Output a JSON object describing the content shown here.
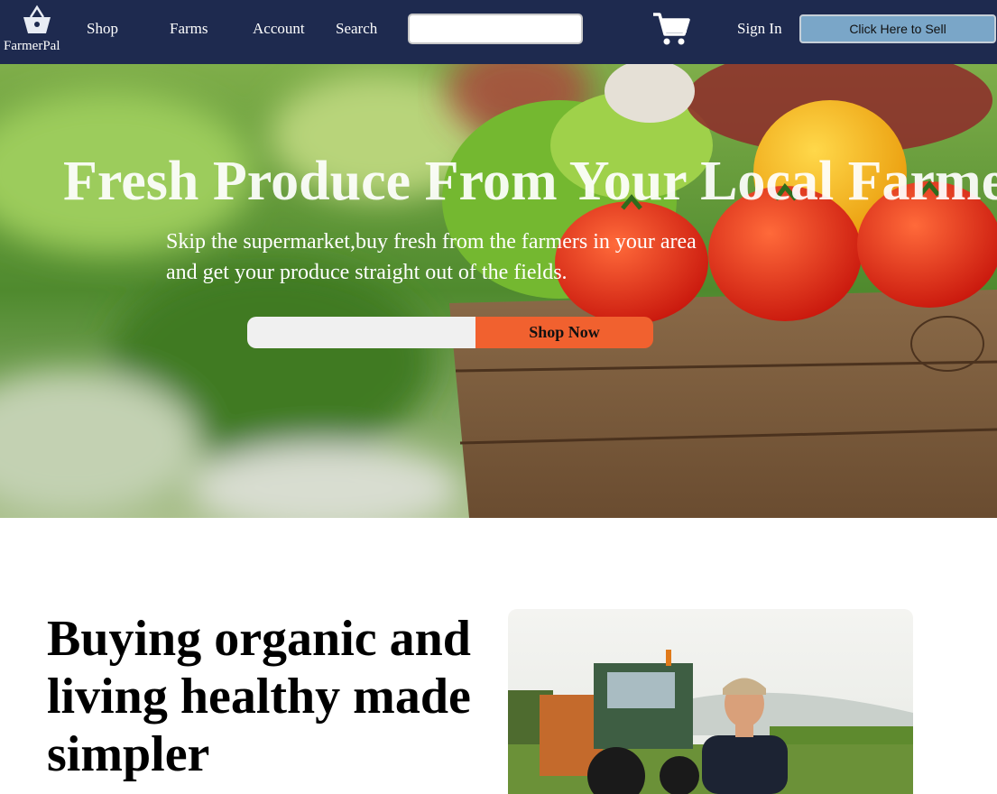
{
  "brand": {
    "name": "FarmerPal",
    "icon": "basket-icon"
  },
  "nav": {
    "links": [
      "Shop",
      "Farms",
      "Account",
      "Search"
    ],
    "search_placeholder": "",
    "cart_icon": "shopping-cart-icon",
    "sign_in": "Sign In",
    "sell_button": "Click Here to Sell"
  },
  "hero": {
    "title": "Fresh Produce From Your Local Farmers",
    "subtitle": "Skip the supermarket,buy fresh from the farmers in your area and get your produce straight out of the fields.",
    "input_placeholder": "",
    "cta": "Shop Now"
  },
  "section": {
    "title": "Buying organic and living healthy made simpler"
  },
  "colors": {
    "nav_bg": "#1e2a4f",
    "sell_btn": "#7aa6c8",
    "cta": "#f1612f"
  }
}
